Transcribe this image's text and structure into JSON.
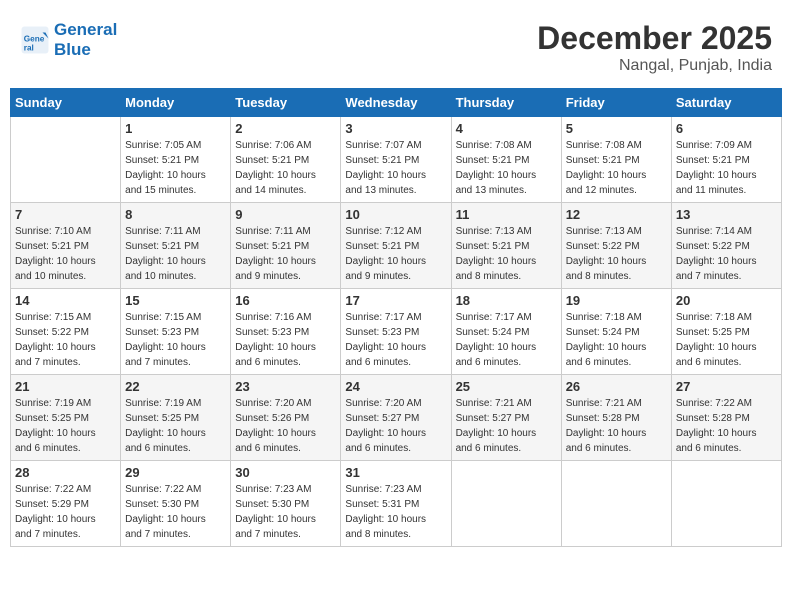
{
  "header": {
    "logo_line1": "General",
    "logo_line2": "Blue",
    "month": "December 2025",
    "location": "Nangal, Punjab, India"
  },
  "weekdays": [
    "Sunday",
    "Monday",
    "Tuesday",
    "Wednesday",
    "Thursday",
    "Friday",
    "Saturday"
  ],
  "weeks": [
    [
      {
        "day": "",
        "info": ""
      },
      {
        "day": "1",
        "info": "Sunrise: 7:05 AM\nSunset: 5:21 PM\nDaylight: 10 hours\nand 15 minutes."
      },
      {
        "day": "2",
        "info": "Sunrise: 7:06 AM\nSunset: 5:21 PM\nDaylight: 10 hours\nand 14 minutes."
      },
      {
        "day": "3",
        "info": "Sunrise: 7:07 AM\nSunset: 5:21 PM\nDaylight: 10 hours\nand 13 minutes."
      },
      {
        "day": "4",
        "info": "Sunrise: 7:08 AM\nSunset: 5:21 PM\nDaylight: 10 hours\nand 13 minutes."
      },
      {
        "day": "5",
        "info": "Sunrise: 7:08 AM\nSunset: 5:21 PM\nDaylight: 10 hours\nand 12 minutes."
      },
      {
        "day": "6",
        "info": "Sunrise: 7:09 AM\nSunset: 5:21 PM\nDaylight: 10 hours\nand 11 minutes."
      }
    ],
    [
      {
        "day": "7",
        "info": "Sunrise: 7:10 AM\nSunset: 5:21 PM\nDaylight: 10 hours\nand 10 minutes."
      },
      {
        "day": "8",
        "info": "Sunrise: 7:11 AM\nSunset: 5:21 PM\nDaylight: 10 hours\nand 10 minutes."
      },
      {
        "day": "9",
        "info": "Sunrise: 7:11 AM\nSunset: 5:21 PM\nDaylight: 10 hours\nand 9 minutes."
      },
      {
        "day": "10",
        "info": "Sunrise: 7:12 AM\nSunset: 5:21 PM\nDaylight: 10 hours\nand 9 minutes."
      },
      {
        "day": "11",
        "info": "Sunrise: 7:13 AM\nSunset: 5:21 PM\nDaylight: 10 hours\nand 8 minutes."
      },
      {
        "day": "12",
        "info": "Sunrise: 7:13 AM\nSunset: 5:22 PM\nDaylight: 10 hours\nand 8 minutes."
      },
      {
        "day": "13",
        "info": "Sunrise: 7:14 AM\nSunset: 5:22 PM\nDaylight: 10 hours\nand 7 minutes."
      }
    ],
    [
      {
        "day": "14",
        "info": "Sunrise: 7:15 AM\nSunset: 5:22 PM\nDaylight: 10 hours\nand 7 minutes."
      },
      {
        "day": "15",
        "info": "Sunrise: 7:15 AM\nSunset: 5:23 PM\nDaylight: 10 hours\nand 7 minutes."
      },
      {
        "day": "16",
        "info": "Sunrise: 7:16 AM\nSunset: 5:23 PM\nDaylight: 10 hours\nand 6 minutes."
      },
      {
        "day": "17",
        "info": "Sunrise: 7:17 AM\nSunset: 5:23 PM\nDaylight: 10 hours\nand 6 minutes."
      },
      {
        "day": "18",
        "info": "Sunrise: 7:17 AM\nSunset: 5:24 PM\nDaylight: 10 hours\nand 6 minutes."
      },
      {
        "day": "19",
        "info": "Sunrise: 7:18 AM\nSunset: 5:24 PM\nDaylight: 10 hours\nand 6 minutes."
      },
      {
        "day": "20",
        "info": "Sunrise: 7:18 AM\nSunset: 5:25 PM\nDaylight: 10 hours\nand 6 minutes."
      }
    ],
    [
      {
        "day": "21",
        "info": "Sunrise: 7:19 AM\nSunset: 5:25 PM\nDaylight: 10 hours\nand 6 minutes."
      },
      {
        "day": "22",
        "info": "Sunrise: 7:19 AM\nSunset: 5:25 PM\nDaylight: 10 hours\nand 6 minutes."
      },
      {
        "day": "23",
        "info": "Sunrise: 7:20 AM\nSunset: 5:26 PM\nDaylight: 10 hours\nand 6 minutes."
      },
      {
        "day": "24",
        "info": "Sunrise: 7:20 AM\nSunset: 5:27 PM\nDaylight: 10 hours\nand 6 minutes."
      },
      {
        "day": "25",
        "info": "Sunrise: 7:21 AM\nSunset: 5:27 PM\nDaylight: 10 hours\nand 6 minutes."
      },
      {
        "day": "26",
        "info": "Sunrise: 7:21 AM\nSunset: 5:28 PM\nDaylight: 10 hours\nand 6 minutes."
      },
      {
        "day": "27",
        "info": "Sunrise: 7:22 AM\nSunset: 5:28 PM\nDaylight: 10 hours\nand 6 minutes."
      }
    ],
    [
      {
        "day": "28",
        "info": "Sunrise: 7:22 AM\nSunset: 5:29 PM\nDaylight: 10 hours\nand 7 minutes."
      },
      {
        "day": "29",
        "info": "Sunrise: 7:22 AM\nSunset: 5:30 PM\nDaylight: 10 hours\nand 7 minutes."
      },
      {
        "day": "30",
        "info": "Sunrise: 7:23 AM\nSunset: 5:30 PM\nDaylight: 10 hours\nand 7 minutes."
      },
      {
        "day": "31",
        "info": "Sunrise: 7:23 AM\nSunset: 5:31 PM\nDaylight: 10 hours\nand 8 minutes."
      },
      {
        "day": "",
        "info": ""
      },
      {
        "day": "",
        "info": ""
      },
      {
        "day": "",
        "info": ""
      }
    ]
  ]
}
